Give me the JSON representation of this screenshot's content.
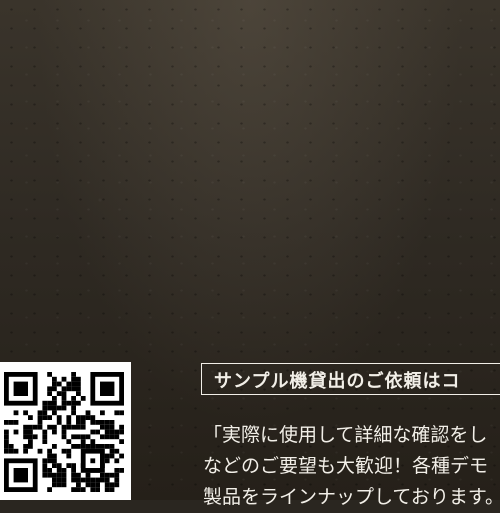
{
  "heading": "サンプル機貸出のご依頼はコ",
  "description": [
    "「実際に使用して詳細な確認をし",
    "などのご要望も大歓迎！各種デモ",
    "製品をラインナップしております。"
  ],
  "colors": {
    "background": "#2a2620",
    "text": "#f2efe8",
    "qr_background": "#ffffff"
  },
  "icons": {
    "qr": "qr-code-icon"
  }
}
